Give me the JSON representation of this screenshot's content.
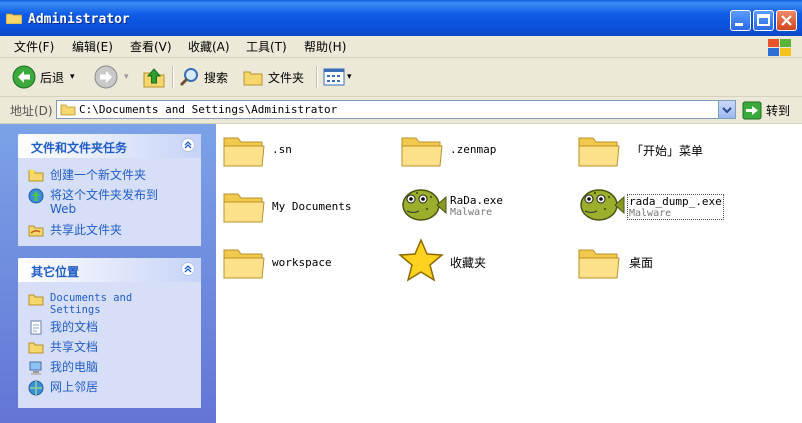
{
  "window": {
    "title": "Administrator"
  },
  "menu": [
    "文件(F)",
    "编辑(E)",
    "查看(V)",
    "收藏(A)",
    "工具(T)",
    "帮助(H)"
  ],
  "toolbar": {
    "back": "后退",
    "search": "搜索",
    "folders": "文件夹"
  },
  "address": {
    "label": "地址(D)",
    "path": "C:\\Documents and Settings\\Administrator",
    "go": "转到"
  },
  "tasks": {
    "title": "文件和文件夹任务",
    "items": [
      "创建一个新文件夹",
      "将这个文件夹发布到",
      "Web",
      "共享此文件夹"
    ]
  },
  "places": {
    "title": "其它位置",
    "items": [
      "Documents and",
      "Settings",
      "我的文档",
      "共享文档",
      "我的电脑",
      "网上邻居"
    ]
  },
  "files": [
    {
      "name": ".sn",
      "type": "folder"
    },
    {
      "name": ".zenmap",
      "type": "folder"
    },
    {
      "name": "「开始」菜单",
      "type": "folder"
    },
    {
      "name": "My Documents",
      "type": "folder"
    },
    {
      "name": "RaDa.exe",
      "sub": "Malware",
      "type": "malware"
    },
    {
      "name": "rada_dump_.exe",
      "sub": "Malware",
      "type": "malware"
    },
    {
      "name": "workspace",
      "type": "folder"
    },
    {
      "name": "收藏夹",
      "type": "favorites"
    },
    {
      "name": "桌面",
      "type": "folder"
    }
  ]
}
